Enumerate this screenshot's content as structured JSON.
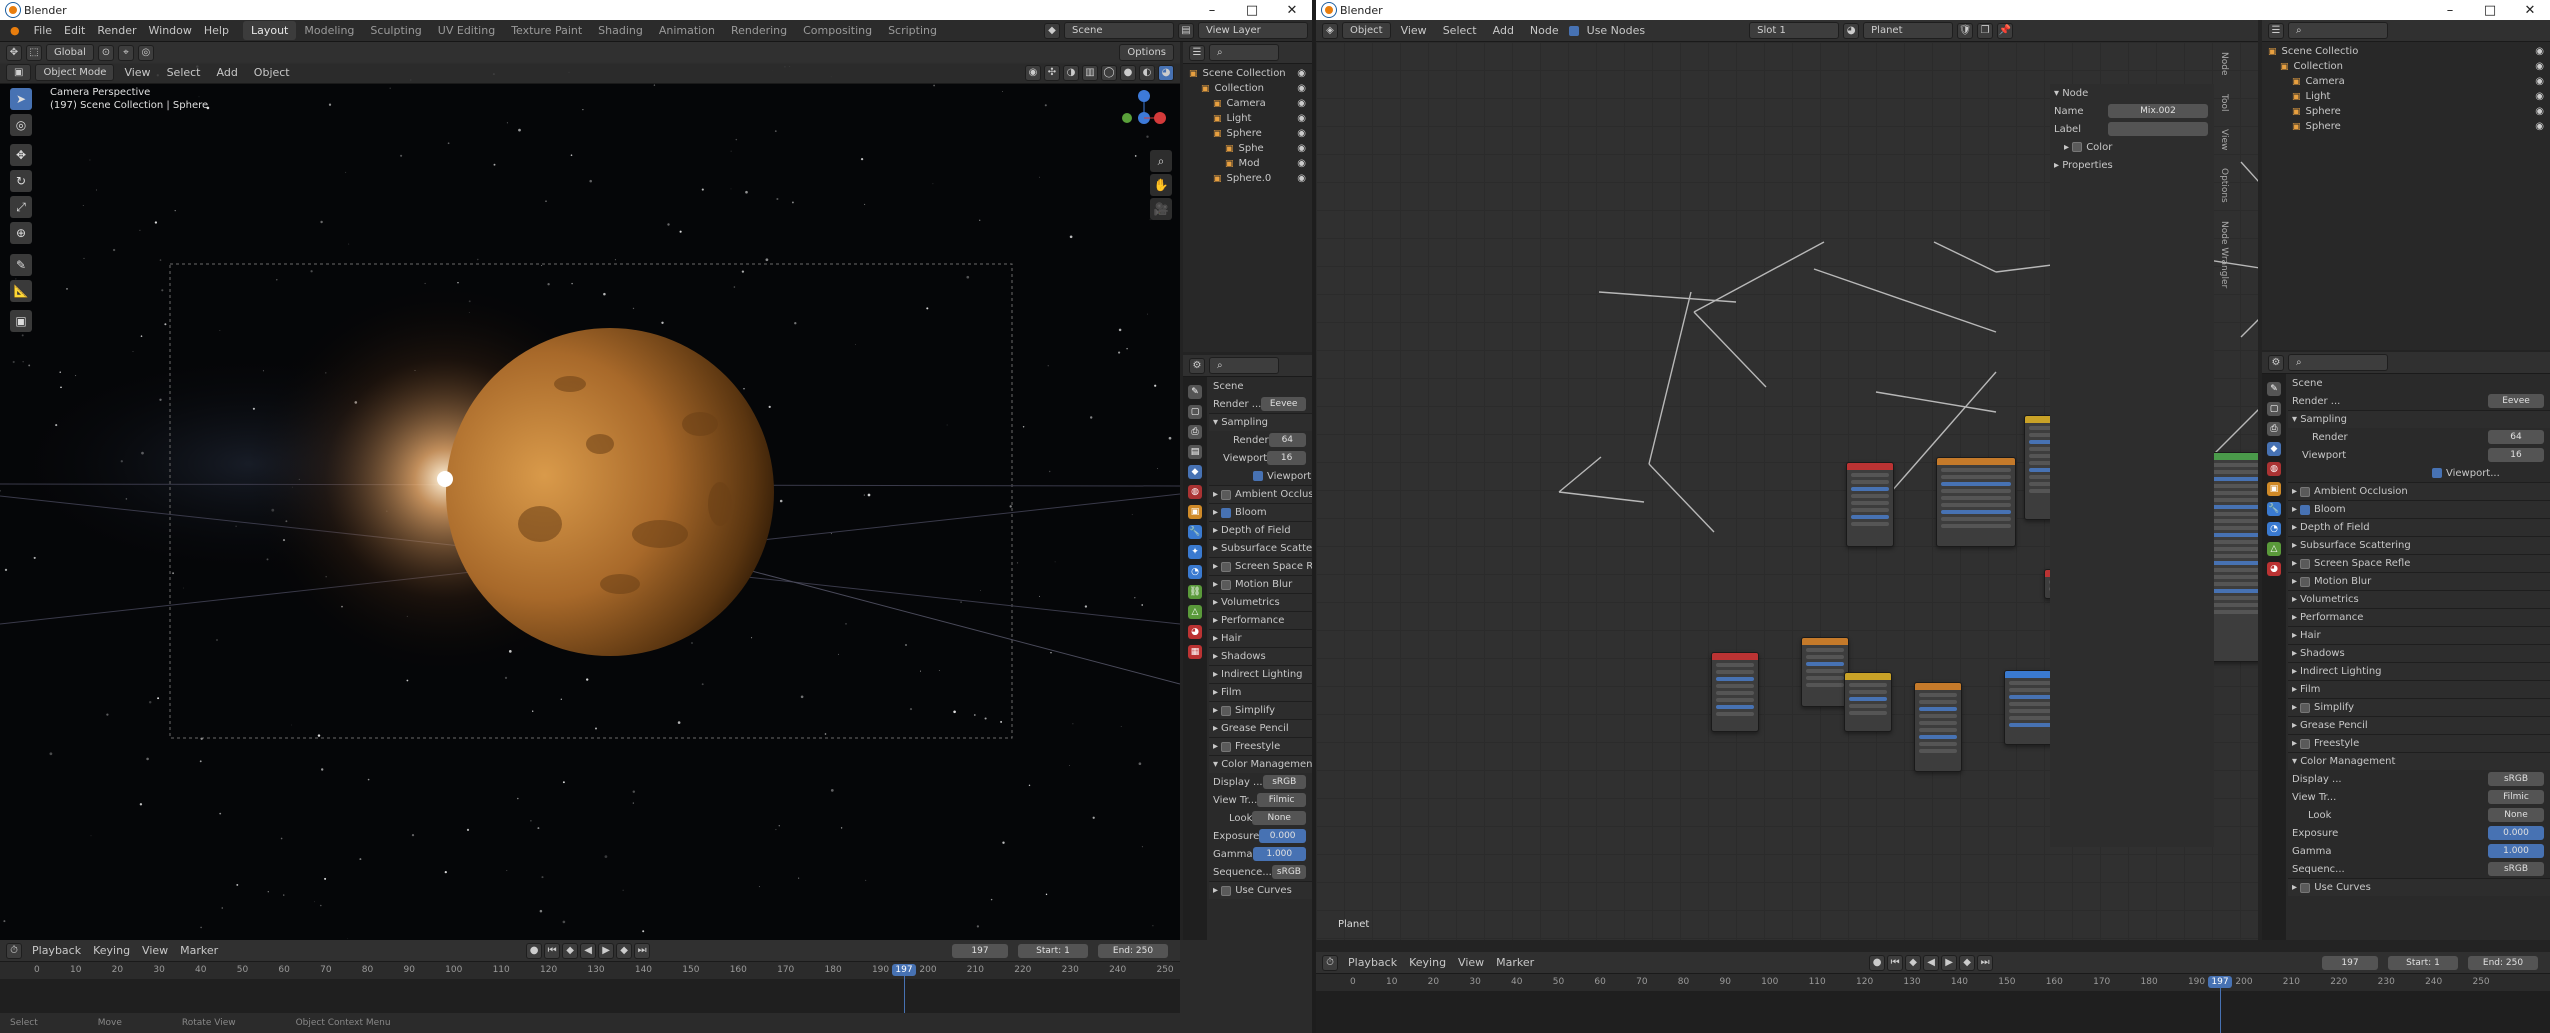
{
  "colors": {
    "accent": "#4772b3",
    "orange": "#e87d0d"
  },
  "win1": {
    "title": "Blender",
    "menus": [
      "File",
      "Edit",
      "Render",
      "Window",
      "Help"
    ],
    "workspaces": [
      {
        "label": "Layout",
        "active": true
      },
      {
        "label": "Modeling"
      },
      {
        "label": "Sculpting"
      },
      {
        "label": "UV Editing"
      },
      {
        "label": "Texture Paint"
      },
      {
        "label": "Shading"
      },
      {
        "label": "Animation"
      },
      {
        "label": "Rendering"
      },
      {
        "label": "Compositing"
      },
      {
        "label": "Scripting"
      }
    ],
    "scene": "Scene",
    "view_layer": "View Layer",
    "viewport_header": {
      "mode": "Object Mode",
      "view": "View",
      "select": "Select",
      "add": "Add",
      "object": "Object",
      "orientation": "Global",
      "options": "Options"
    },
    "viewport_info": [
      "Camera Perspective",
      "(197) Scene Collection | Sphere"
    ],
    "outliner": [
      {
        "label": "Scene Collection",
        "indent": 0,
        "icon": "scene-collection-icon"
      },
      {
        "label": "Collection",
        "indent": 1,
        "icon": "collection-icon"
      },
      {
        "label": "Camera",
        "indent": 2,
        "icon": "camera-icon"
      },
      {
        "label": "Light",
        "indent": 2,
        "icon": "light-icon"
      },
      {
        "label": "Sphere",
        "indent": 2,
        "icon": "mesh-icon"
      },
      {
        "label": "Sphe",
        "indent": 3,
        "icon": "mesh-data-icon"
      },
      {
        "label": "Mod",
        "indent": 3,
        "icon": "modifier-icon"
      },
      {
        "label": "Sphere.0",
        "indent": 2,
        "icon": "mesh-icon"
      }
    ],
    "props": {
      "scene_label": "Scene",
      "render_engine_label": "Render ...",
      "render_engine": "Eevee",
      "sampling": "Sampling",
      "render_label": "Render",
      "render_val": "64",
      "viewport_label": "Viewport",
      "viewport_val": "16",
      "viewport_denoise": "Viewport...",
      "sections": [
        {
          "label": "Ambient Occlusion",
          "cb": true,
          "on": false
        },
        {
          "label": "Bloom",
          "cb": true,
          "on": true
        },
        {
          "label": "Depth of Field"
        },
        {
          "label": "Subsurface Scattering"
        },
        {
          "label": "Screen Space Reflec",
          "cb": true,
          "on": false
        },
        {
          "label": "Motion Blur",
          "cb": true,
          "on": false
        },
        {
          "label": "Volumetrics"
        },
        {
          "label": "Performance"
        },
        {
          "label": "Hair"
        },
        {
          "label": "Shadows"
        },
        {
          "label": "Indirect Lighting"
        },
        {
          "label": "Film"
        },
        {
          "label": "Simplify",
          "cb": true,
          "on": false
        },
        {
          "label": "Grease Pencil"
        },
        {
          "label": "Freestyle",
          "cb": true,
          "on": false
        }
      ],
      "color_management": "Color Management",
      "display_label": "Display ...",
      "display_val": "sRGB",
      "view_label": "View Tr...",
      "view_val": "Filmic",
      "look_label": "Look",
      "look_val": "None",
      "exposure_label": "Exposure",
      "exposure_val": "0.000",
      "gamma_label": "Gamma",
      "gamma_val": "1.000",
      "sequencer_label": "Sequence...",
      "sequencer_val": "sRGB",
      "use_curves": "Use Curves"
    },
    "timeline": {
      "menus": [
        "Playback",
        "Keying",
        "View",
        "Marker"
      ],
      "frame": "197",
      "start_label": "Start",
      "start": "1",
      "end_label": "End",
      "end": "250",
      "ticks": [
        "0",
        "10",
        "20",
        "30",
        "40",
        "50",
        "60",
        "70",
        "80",
        "90",
        "100",
        "110",
        "120",
        "130",
        "140",
        "150",
        "160",
        "170",
        "180",
        "190",
        "200",
        "210",
        "220",
        "230",
        "240",
        "250"
      ],
      "current": "197"
    },
    "status": [
      "Select",
      "Move",
      "Rotate View",
      "Object Context Menu"
    ]
  },
  "win2": {
    "title": "Blender",
    "header": {
      "object": "Object",
      "view": "View",
      "select": "Select",
      "add": "Add",
      "node": "Node",
      "use_nodes": "Use Nodes",
      "slot": "Slot 1",
      "material": "Planet"
    },
    "node_editor_label": "Planet",
    "sidebar": {
      "title": "Node",
      "name_label": "Name",
      "name_val": "Mix.002",
      "label_label": "Label",
      "color": "Color",
      "properties": "Properties"
    },
    "sidebar_tabs": [
      "Node",
      "Tool",
      "View",
      "Options",
      "Node Wrangler"
    ],
    "outliner": [
      {
        "label": "Scene Collectio",
        "indent": 0
      },
      {
        "label": "Collection",
        "indent": 1
      },
      {
        "label": "Camera",
        "indent": 2
      },
      {
        "label": "Light",
        "indent": 2
      },
      {
        "label": "Sphere",
        "indent": 2
      },
      {
        "label": "Sphere",
        "indent": 2
      }
    ],
    "props": {
      "scene_label": "Scene",
      "render_label": "Render ...",
      "render_engine": "Eevee",
      "sampling": "Sampling",
      "render_s": "Render",
      "render_v": "64",
      "viewport_s": "Viewport",
      "viewport_v": "16",
      "viewport_dn": "Viewport...",
      "sections": [
        {
          "label": "Ambient Occlusion",
          "cb": true,
          "on": false
        },
        {
          "label": "Bloom",
          "cb": true,
          "on": true
        },
        {
          "label": "Depth of Field"
        },
        {
          "label": "Subsurface Scattering"
        },
        {
          "label": "Screen Space Refle",
          "cb": true,
          "on": false
        },
        {
          "label": "Motion Blur",
          "cb": true,
          "on": false
        },
        {
          "label": "Volumetrics"
        },
        {
          "label": "Performance"
        },
        {
          "label": "Hair"
        },
        {
          "label": "Shadows"
        },
        {
          "label": "Indirect Lighting"
        },
        {
          "label": "Film"
        },
        {
          "label": "Simplify",
          "cb": true,
          "on": false
        },
        {
          "label": "Grease Pencil"
        },
        {
          "label": "Freestyle",
          "cb": true,
          "on": false
        }
      ],
      "color_management": "Color Management",
      "display_label": "Display ...",
      "display_val": "sRGB",
      "view_label": "View Tr...",
      "view_val": "Filmic",
      "look_label": "Look",
      "look_val": "None",
      "exposure_label": "Exposure",
      "exposure_val": "0.000",
      "gamma_label": "Gamma",
      "gamma_val": "1.000",
      "sequencer_label": "Sequenc...",
      "sequencer_val": "sRGB",
      "use_curves": "Use Curves"
    },
    "timeline": {
      "menus": [
        "Playback",
        "Keying",
        "View",
        "Marker"
      ],
      "frame": "197",
      "start_label": "Start",
      "start": "1",
      "end_label": "End",
      "end": "250",
      "ticks": [
        "0",
        "10",
        "20",
        "30",
        "40",
        "50",
        "60",
        "70",
        "80",
        "90",
        "100",
        "110",
        "120",
        "130",
        "140",
        "150",
        "160",
        "170",
        "180",
        "190",
        "200",
        "210",
        "220",
        "230",
        "240",
        "250"
      ],
      "current": "197"
    }
  }
}
